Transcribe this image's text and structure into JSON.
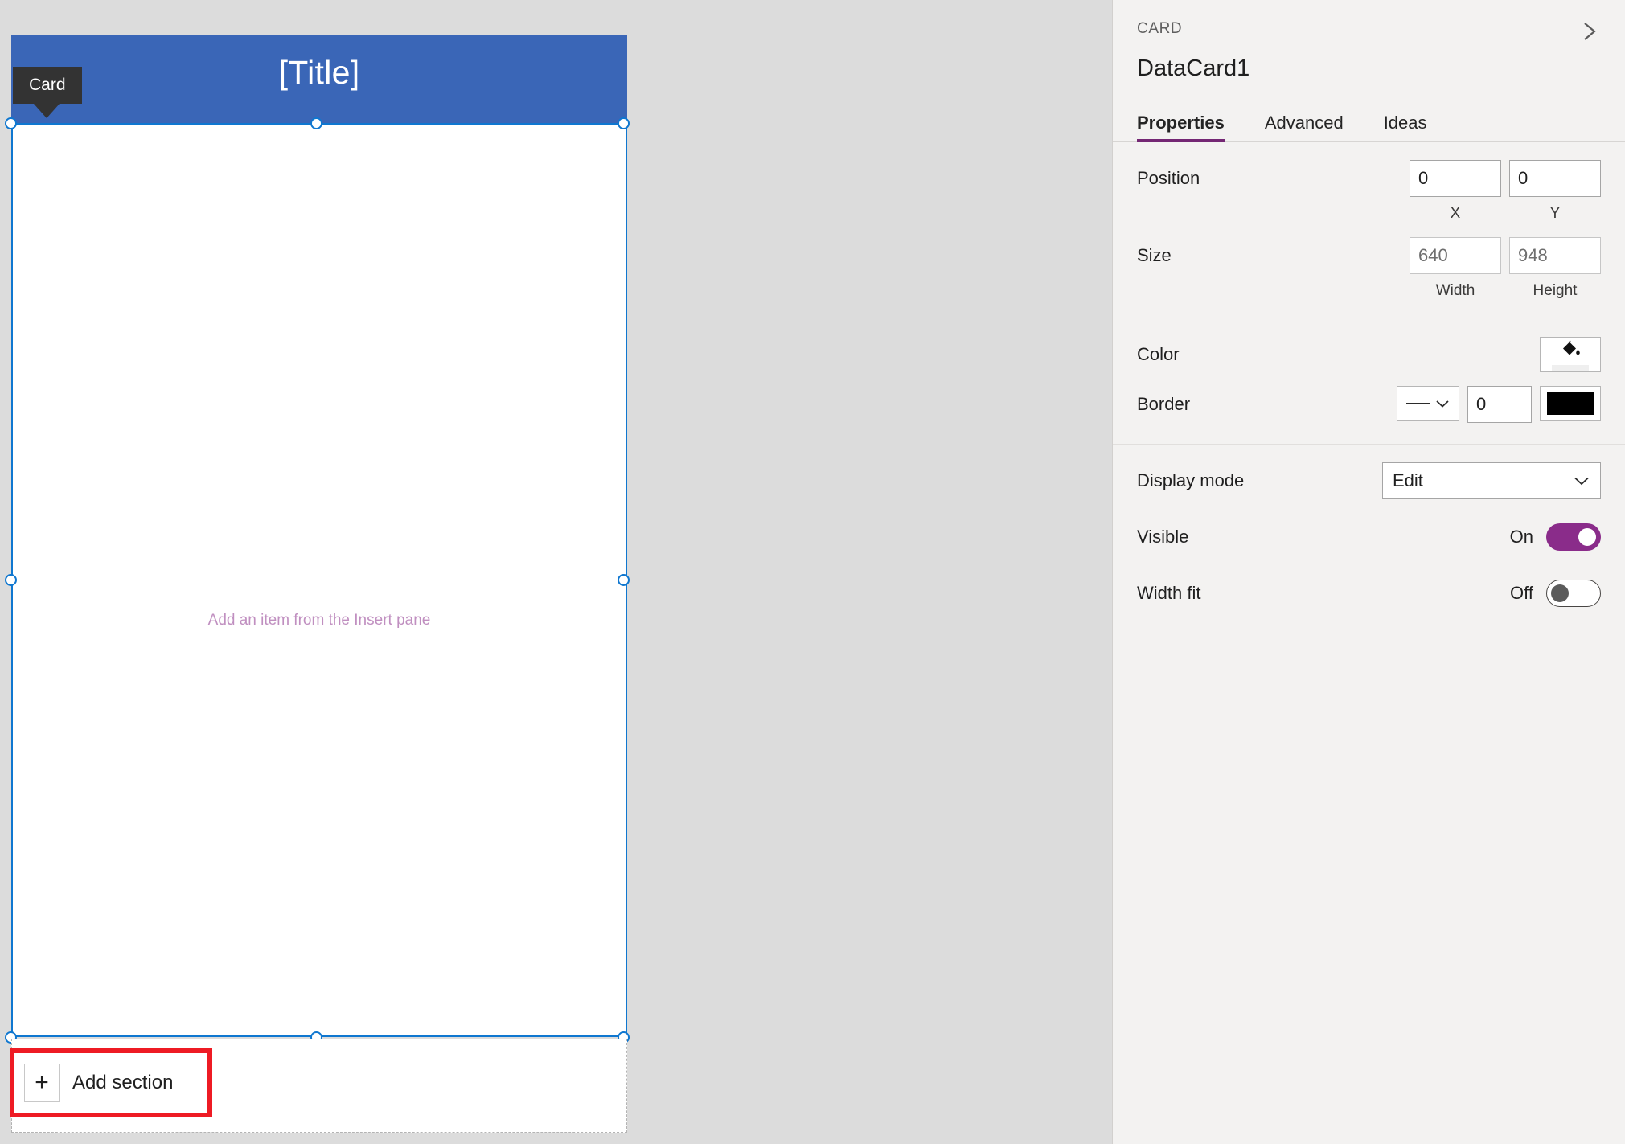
{
  "canvas": {
    "card": {
      "badge_label": "Card",
      "title": "[Title]",
      "placeholder": "Add an item from the Insert pane"
    },
    "add_section": {
      "icon": "plus-icon",
      "label": "Add section"
    }
  },
  "panel": {
    "kicker": "CARD",
    "title": "DataCard1",
    "collapse_icon": "chevron-right-icon",
    "tabs": [
      {
        "label": "Properties",
        "active": true
      },
      {
        "label": "Advanced",
        "active": false
      },
      {
        "label": "Ideas",
        "active": false
      }
    ],
    "position": {
      "label": "Position",
      "x_value": "0",
      "y_value": "0",
      "x_sub": "X",
      "y_sub": "Y"
    },
    "size": {
      "label": "Size",
      "width_value": "640",
      "height_value": "948",
      "width_sub": "Width",
      "height_sub": "Height"
    },
    "color": {
      "label": "Color",
      "icon": "paint-bucket-icon",
      "fill_color": "#efefef"
    },
    "border": {
      "label": "Border",
      "style_icon": "solid-line-icon",
      "width_value": "0",
      "color_value": "#000000"
    },
    "display_mode": {
      "label": "Display mode",
      "value": "Edit",
      "chevron": "chevron-down-icon"
    },
    "visible": {
      "label": "Visible",
      "state": "On",
      "on": true
    },
    "width_fit": {
      "label": "Width fit",
      "state": "Off",
      "on": false
    }
  },
  "colors": {
    "canvas_bg": "#dcdcdc",
    "card_header": "#3a66b7",
    "selection": "#0f77d0",
    "accent_purple": "#742774",
    "toggle_on": "#8a2c8a",
    "highlight_red": "#ee1b24",
    "placeholder_text": "#c08fc0"
  }
}
